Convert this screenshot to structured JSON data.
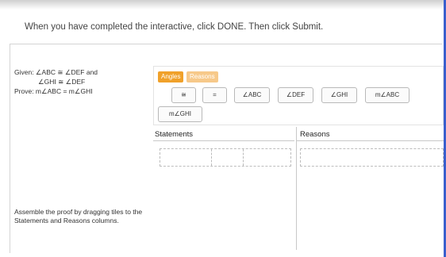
{
  "instruction": "When you have completed the interactive, click DONE. Then click Submit.",
  "problem": {
    "given_line1": "Given: ∠ABC ≅ ∠DEF and",
    "given_line2": "∠GHI ≅ ∠DEF",
    "prove": "Prove: m∠ABC = m∠GHI"
  },
  "help_text": "Assemble the proof by dragging tiles to the Statements and Reasons columns.",
  "tabs": {
    "angles": "Angles",
    "reasons": "Reasons"
  },
  "tiles": {
    "congruent": "≅",
    "equals": "=",
    "angle_abc": "∠ABC",
    "angle_def": "∠DEF",
    "angle_ghi": "∠GHI",
    "m_angle_abc": "m∠ABC",
    "m_angle_ghi": "m∠GHI"
  },
  "table": {
    "statements_header": "Statements",
    "reasons_header": "Reasons"
  },
  "colors": {
    "tab_active": "#f0a12a",
    "tab_inactive": "#f7c98a",
    "window_edge": "#3a5fcd"
  }
}
